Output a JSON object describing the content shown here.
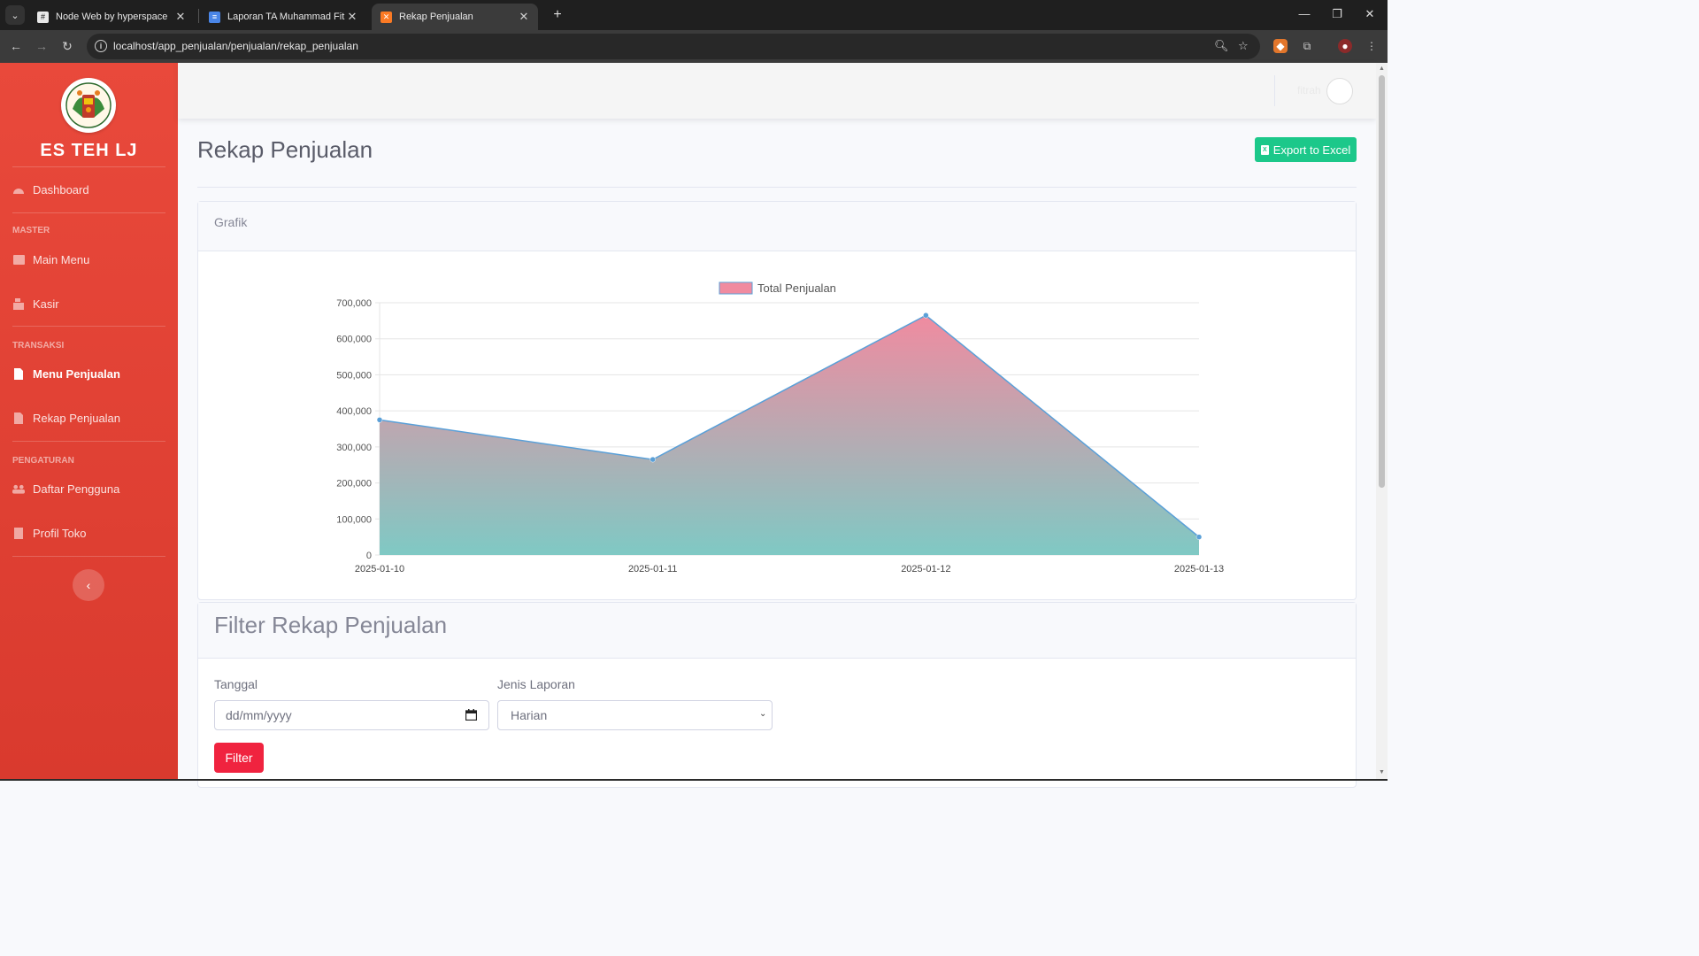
{
  "browser": {
    "tabs": [
      {
        "title": "Node Web by hyperspace",
        "active": false,
        "icon": "hash-grid-icon"
      },
      {
        "title": "Laporan TA Muhammad Fitrah",
        "active": false,
        "icon": "docs-icon"
      },
      {
        "title": "Rekap Penjualan",
        "active": true,
        "icon": "xampp-icon"
      }
    ],
    "url": "localhost/app_penjualan/penjualan/rekap_penjualan"
  },
  "sidebar": {
    "brand": "ES TEH LJ",
    "sections": [
      {
        "heading": "",
        "items": [
          {
            "label": "Dashboard",
            "icon": "tachometer-icon"
          }
        ]
      },
      {
        "heading": "MASTER",
        "items": [
          {
            "label": "Main Menu",
            "icon": "table-icon"
          },
          {
            "label": "Kasir",
            "icon": "cash-register-icon"
          }
        ]
      },
      {
        "heading": "TRANSAKSI",
        "items": [
          {
            "label": "Menu Penjualan",
            "icon": "file-icon",
            "active": true
          },
          {
            "label": "Rekap Penjualan",
            "icon": "file-icon"
          }
        ]
      },
      {
        "heading": "PENGATURAN",
        "items": [
          {
            "label": "Daftar Pengguna",
            "icon": "users-icon"
          },
          {
            "label": "Profil Toko",
            "icon": "building-icon"
          }
        ]
      }
    ]
  },
  "topbar": {
    "user_name": "fitrah"
  },
  "page": {
    "title": "Rekap Penjualan",
    "export_label": "Export to Excel",
    "chart_card_title": "Grafik",
    "filter_title": "Filter Rekap Penjualan",
    "date_label": "Tanggal",
    "date_placeholder": "dd/mm/yyyy",
    "type_label": "Jenis Laporan",
    "type_selected": "Harian",
    "filter_button": "Filter"
  },
  "colors": {
    "sidebar": "#e9493b",
    "success": "#1cc88a",
    "danger": "#f0233f",
    "series_fill_top": "#f08ba0",
    "series_fill_bottom": "#7fc9c4",
    "series_line": "#5aa0d8"
  },
  "chart_data": {
    "type": "area",
    "title": "",
    "xlabel": "",
    "ylabel": "",
    "legend": "top-center",
    "grid": true,
    "categories": [
      "2025-01-10",
      "2025-01-11",
      "2025-01-12",
      "2025-01-13"
    ],
    "series": [
      {
        "name": "Total Penjualan",
        "values": [
          375000,
          265000,
          665000,
          50000
        ]
      }
    ],
    "ylim": [
      0,
      700000
    ],
    "yticks": [
      "0",
      "100,000",
      "200,000",
      "300,000",
      "400,000",
      "500,000",
      "600,000",
      "700,000"
    ]
  }
}
